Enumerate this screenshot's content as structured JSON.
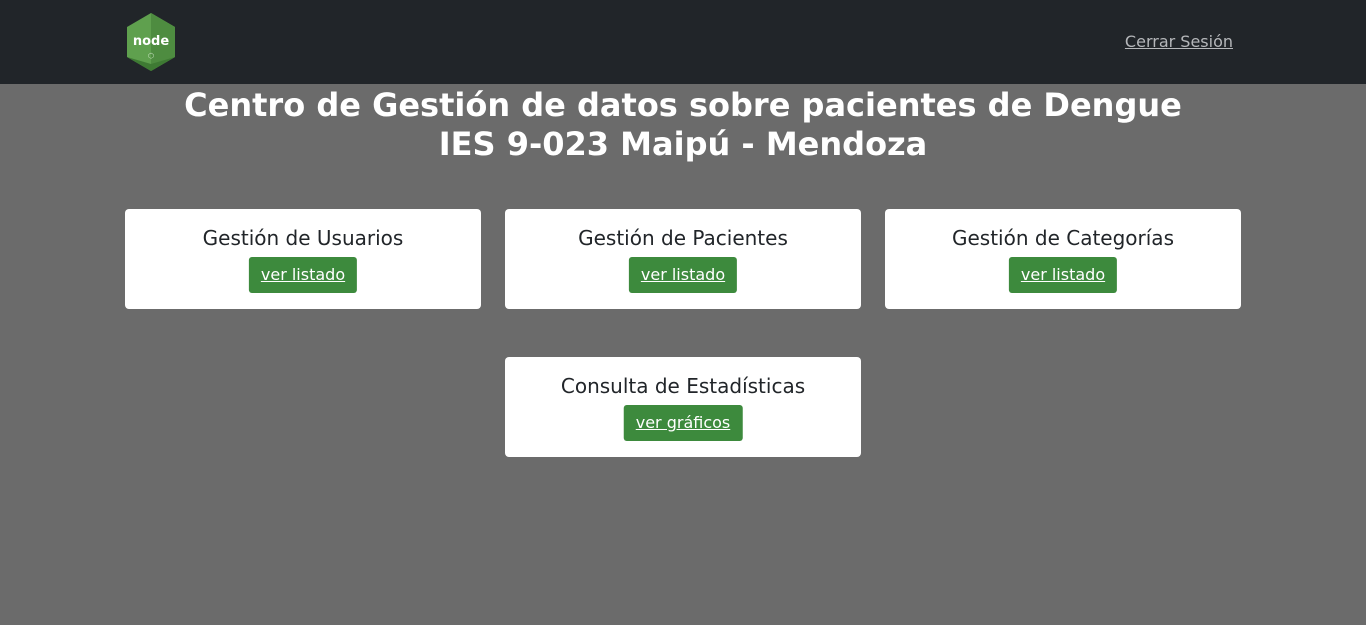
{
  "navbar": {
    "logo_text": "node",
    "logout_label": "Cerrar Sesión"
  },
  "header": {
    "title_line1": "Centro de Gestión de datos sobre pacientes de Dengue",
    "title_line2": "IES 9-023 Maipú - Mendoza"
  },
  "cards": [
    {
      "title": "Gestión de Usuarios",
      "button": "ver listado"
    },
    {
      "title": "Gestión de Pacientes",
      "button": "ver listado"
    },
    {
      "title": "Gestión de Categorías",
      "button": "ver listado"
    },
    {
      "title": "Consulta de Estadísticas",
      "button": "ver gráficos"
    }
  ],
  "colors": {
    "navbar": "#212529",
    "background": "#6b6b6b",
    "button": "#3d8a3d",
    "logo": "#5fa04e"
  }
}
